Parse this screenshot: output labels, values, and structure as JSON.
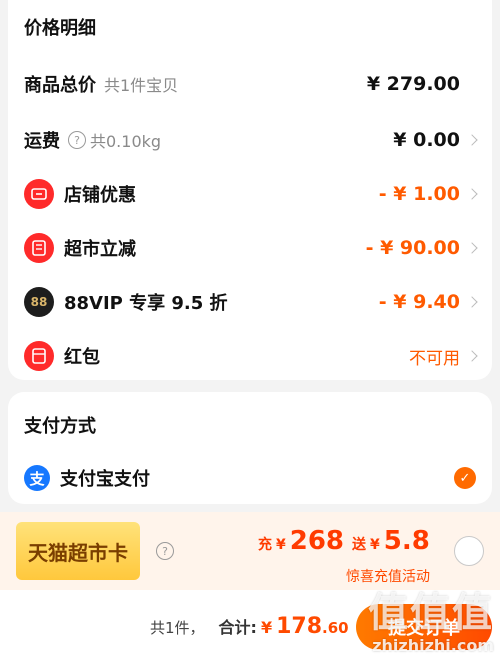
{
  "price_detail": {
    "title": "价格明细",
    "total": {
      "label": "商品总价",
      "sub": "共1件宝贝",
      "value": "¥ 279.00"
    },
    "shipping": {
      "label": "运费",
      "sub": "共0.10kg",
      "value": "¥ 0.00"
    },
    "items": [
      {
        "label": "店铺优惠",
        "value": "- ¥ 1.00",
        "icon": "ticket-icon"
      },
      {
        "label": "超市立减",
        "value": "- ¥ 90.00",
        "icon": "supermarket-icon"
      },
      {
        "label": "88VIP 专享 9.5 折",
        "value": "- ¥ 9.40",
        "icon": "88vip-icon",
        "icon_text": "88"
      },
      {
        "label": "红包",
        "value": "不可用",
        "icon": "red-packet-icon"
      }
    ]
  },
  "payment": {
    "title": "支付方式",
    "method": {
      "label": "支付宝支付",
      "icon_text": "支"
    }
  },
  "promo": {
    "card_label": "天猫超市卡",
    "recharge_prefix": "充",
    "recharge_currency": "¥",
    "recharge_amount": "268",
    "bonus_prefix": "送",
    "bonus_currency": "¥",
    "bonus_amount": "5.8",
    "subtitle": "惊喜充值活动"
  },
  "footer": {
    "count": "共1件，",
    "total_label": "合计:",
    "currency": "¥",
    "total_int": "178",
    "total_dec": ".60",
    "submit_label": "提交订单"
  },
  "watermark": {
    "text": "值值值",
    "url": "zhizhizhi.com"
  },
  "colors": {
    "accent": "#ff5a00",
    "alipay": "#1678ff",
    "red_icon": "#ff2a2a"
  }
}
